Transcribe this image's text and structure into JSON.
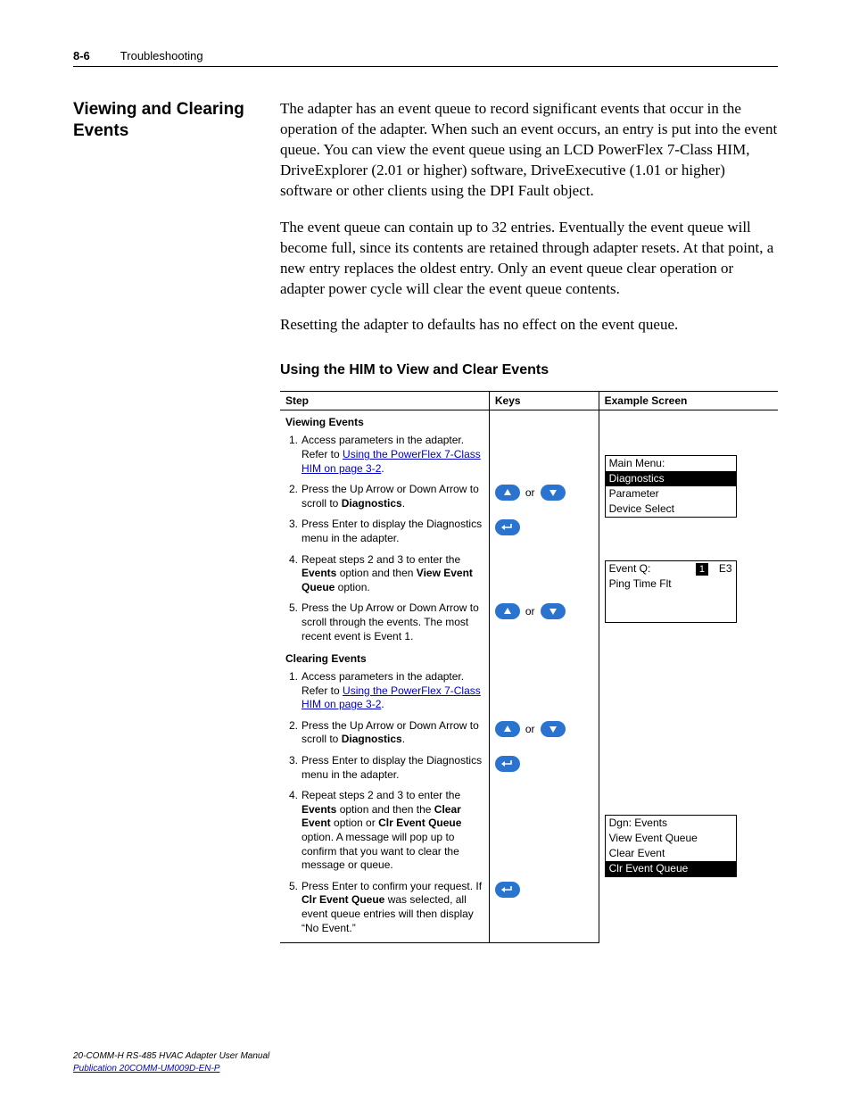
{
  "header": {
    "page_num": "8-6",
    "section": "Troubleshooting"
  },
  "side_heading": "Viewing and Clearing Events",
  "paragraphs": {
    "p1": "The adapter has an event queue to record significant events that occur in the operation of the adapter. When such an event occurs, an entry is put into the event queue. You can view the event queue using an LCD PowerFlex 7-Class HIM, DriveExplorer (2.01 or higher) software, DriveExecutive (1.01 or higher) software or other clients using the DPI Fault object.",
    "p2": "The event queue can contain up to 32 entries. Eventually the event queue will become full, since its contents are retained through adapter resets. At that point, a new entry replaces the oldest entry. Only an event queue clear operation or adapter power cycle will clear the event queue contents.",
    "p3": "Resetting the adapter to defaults has no effect on the event queue."
  },
  "sub_heading": "Using the HIM to View and Clear Events",
  "table_headers": {
    "step": "Step",
    "keys": "Keys",
    "example": "Example Screen"
  },
  "row_headings": {
    "viewing": "Viewing Events",
    "clearing": "Clearing Events"
  },
  "link_text": "Using the PowerFlex 7-Class HIM on page 3-2",
  "viewing_steps": {
    "s1a": "Access parameters in the adapter. Refer to ",
    "s1c": ".",
    "s2a": "Press the Up Arrow or Down Arrow to scroll to ",
    "s2b": "Diagnostics",
    "s2c": ".",
    "s3": "Press Enter to display the Diagnostics menu in the adapter.",
    "s4a": "Repeat steps 2 and 3 to enter the ",
    "s4b": "Events",
    "s4c": " option and then ",
    "s4d": "View Event Queue",
    "s4e": " option.",
    "s5": "Press the Up Arrow or Down Arrow to scroll through the events. The most recent event is Event 1."
  },
  "clearing_steps": {
    "s1a": "Access parameters in the adapter. Refer to ",
    "s1c": ".",
    "s2a": "Press the Up Arrow or Down Arrow to scroll to ",
    "s2b": "Diagnostics",
    "s2c": ".",
    "s3": "Press Enter to display the Diagnostics menu in the adapter.",
    "s4a": "Repeat steps 2 and 3 to enter the ",
    "s4b": "Events",
    "s4c": " option and then the ",
    "s4d": "Clear Event",
    "s4e": " option or ",
    "s4f": "Clr Event Queue",
    "s4g": " option. A message will pop up to confirm that you want to clear the message or queue.",
    "s5a": "Press Enter to confirm your request. If ",
    "s5b": "Clr Event Queue",
    "s5c": " was selected, all event queue entries will then display “No Event.”"
  },
  "keys_or": "or",
  "lcd1": {
    "l0": "Main Menu:",
    "l1": "Diagnostics",
    "l2": "Parameter",
    "l3": "Device Select"
  },
  "lcd2": {
    "label": "Event Q:",
    "num": "1",
    "code": "E3",
    "l2": "Ping Time Flt"
  },
  "lcd3": {
    "l0": "Dgn: Events",
    "l1": "View Event Queue",
    "l2": "Clear Event",
    "l3": "Clr Event Queue"
  },
  "footer": {
    "l1": "20-COMM-H RS-485 HVAC Adapter User Manual",
    "l2": "Publication 20COMM-UM009D-EN-P"
  }
}
